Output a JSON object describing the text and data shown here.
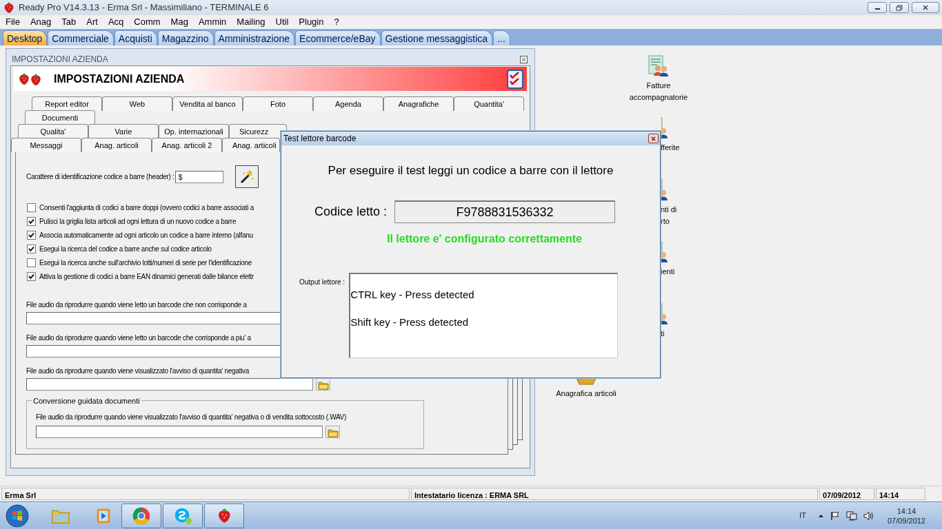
{
  "window": {
    "title": "Ready Pro V14.3.13 - Erma Srl - Massimiliano - TERMINALE 6"
  },
  "menu": [
    "File",
    "Anag",
    "Tab",
    "Art",
    "Acq",
    "Comm",
    "Mag",
    "Ammin",
    "Mailing",
    "Util",
    "Plugin",
    "?"
  ],
  "main_tabs": [
    {
      "label": "Desktop",
      "selected": true
    },
    {
      "label": "Commerciale",
      "selected": false
    },
    {
      "label": "Acquisti",
      "selected": false
    },
    {
      "label": "Magazzino",
      "selected": false
    },
    {
      "label": "Amministrazione",
      "selected": false
    },
    {
      "label": "Ecommerce/eBay",
      "selected": false
    },
    {
      "label": "Gestione messaggistica",
      "selected": false
    },
    {
      "label": "...",
      "selected": false
    }
  ],
  "settings_window": {
    "title": "IMPOSTAZIONI AZIENDA",
    "banner_title": "IMPOSTAZIONI AZIENDA",
    "tab_rows": [
      [
        "Report editor",
        "Web",
        "Vendita al banco",
        "Foto",
        "Agenda",
        "Anagrafiche",
        "Quantita'"
      ],
      [
        "Documenti"
      ],
      [
        "Qualita'",
        "Varie",
        "Op. internazionali",
        "Sicurezz"
      ],
      [
        "Messaggi",
        "Anag. articoli",
        "Anag. articoli 2",
        "Anag. articoli"
      ]
    ],
    "header_field": {
      "label": "Carattere di identificazione codice a barre (header) :",
      "value": "$"
    },
    "checkboxes": [
      {
        "label": "Consenti l'aggiunta di codici a barre doppi (ovvero codici a barre associati a",
        "checked": false
      },
      {
        "label": "Pulisci la griglia lista articoli ad ogni lettura di un nuovo codice a barre",
        "checked": true
      },
      {
        "label": "Associa automaticamente ad ogni articolo un codice a barre interno (alfanu",
        "checked": true
      },
      {
        "label": "Esegui la ricerca del codice a barre anche sul codice articolo",
        "checked": true
      },
      {
        "label": "Esegui la ricerca anche sull'archivio lotti/numeri di serie per l'identificazione",
        "checked": false
      },
      {
        "label": "Attiva la gestione di codici a barre EAN dinamici generati dalle bilance elettr",
        "checked": true
      }
    ],
    "audio_fields": [
      {
        "label": "File audio da riprodurre quando viene letto un barcode che non corrisponde a",
        "kind": "plain"
      },
      {
        "label": "File audio da riprodurre quando viene letto un barcode che corrisponde a piu' a",
        "kind": "plain"
      },
      {
        "label": "File audio da riprodurre quando viene visualizzato l'avviso di quantita' negativa",
        "kind": "browse"
      }
    ],
    "group": {
      "legend": "Conversione guidata documenti",
      "label": "File audio da riprodurre quando viene visualizzato l'avviso di quantita' negativa o di vendita sottocosto (.WAV)"
    }
  },
  "dialog": {
    "title": "Test lettore barcode",
    "instruction": "Per eseguire il test leggi un codice a barre con il lettore",
    "code_label": "Codice letto :",
    "code_value": "F9788831536332",
    "status": "Il lettore e' configurato correttamente",
    "output_label": "Output lettore :",
    "output_lines": [
      "CTRL key - Press detected",
      "Shift key - Press detected"
    ]
  },
  "desktop_icons": [
    {
      "label": "Fatture accompagnatorie",
      "kind": "full"
    },
    {
      "label": "fferite",
      "kind": "clipped-left"
    },
    {
      "label": "nti di rto",
      "kind": "clipped-left"
    },
    {
      "label": "ienti",
      "kind": "clipped-left"
    },
    {
      "label": "ti",
      "kind": "clipped-left"
    },
    {
      "label": "Anagrafica articoli",
      "kind": "clipped-top"
    }
  ],
  "status_bar": [
    "Erma Srl",
    "Intestatario licenza : ERMA SRL",
    "07/09/2012",
    "14:14"
  ],
  "taskbar": {
    "apps": [
      {
        "kind": "explorer",
        "running": false
      },
      {
        "kind": "media",
        "running": false
      },
      {
        "kind": "chrome",
        "running": true
      },
      {
        "kind": "skype",
        "running": true
      },
      {
        "kind": "strawberry",
        "running": true
      }
    ],
    "language": "IT",
    "clock_time": "14:14",
    "clock_date": "07/09/2012"
  }
}
